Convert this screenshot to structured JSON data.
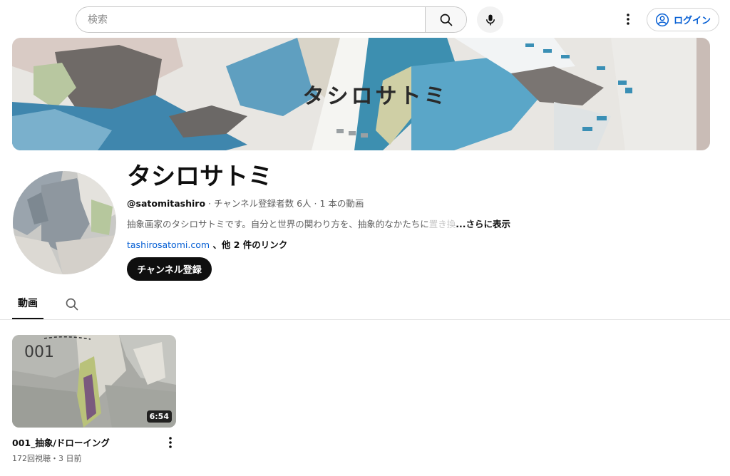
{
  "header": {
    "search_placeholder": "検索",
    "login_label": "ログイン",
    "icons": {
      "search": "search-icon",
      "mic": "mic-icon",
      "more": "more-vertical-icon",
      "account": "account-circle-icon"
    }
  },
  "banner": {
    "title": "タシロサトミ"
  },
  "channel": {
    "name": "タシロサトミ",
    "handle": "@satomitashiro",
    "stats": " · チャンネル登録者数 6人 · 1 本の動画",
    "description": "抽象画家のタシロサトミです。自分と世界の関わり方を、抽象的なかたちに",
    "description_fade": "置き換",
    "description_more": "...さらに表示",
    "link_text": "tashirosatomi.com",
    "link_rest": " 、他 2 件のリンク",
    "subscribe_label": "チャンネル登録"
  },
  "tabs": [
    {
      "label": "動画",
      "selected": true
    }
  ],
  "videos": [
    {
      "thumb_label": "001",
      "duration": "6:54",
      "title": "001_抽象/ドローイング",
      "meta": "172回視聴・3 日前"
    }
  ],
  "colors": {
    "link": "#065fd4",
    "text": "#0f0f0f",
    "secondary": "#606060",
    "subscribe_bg": "#0f0f0f"
  }
}
